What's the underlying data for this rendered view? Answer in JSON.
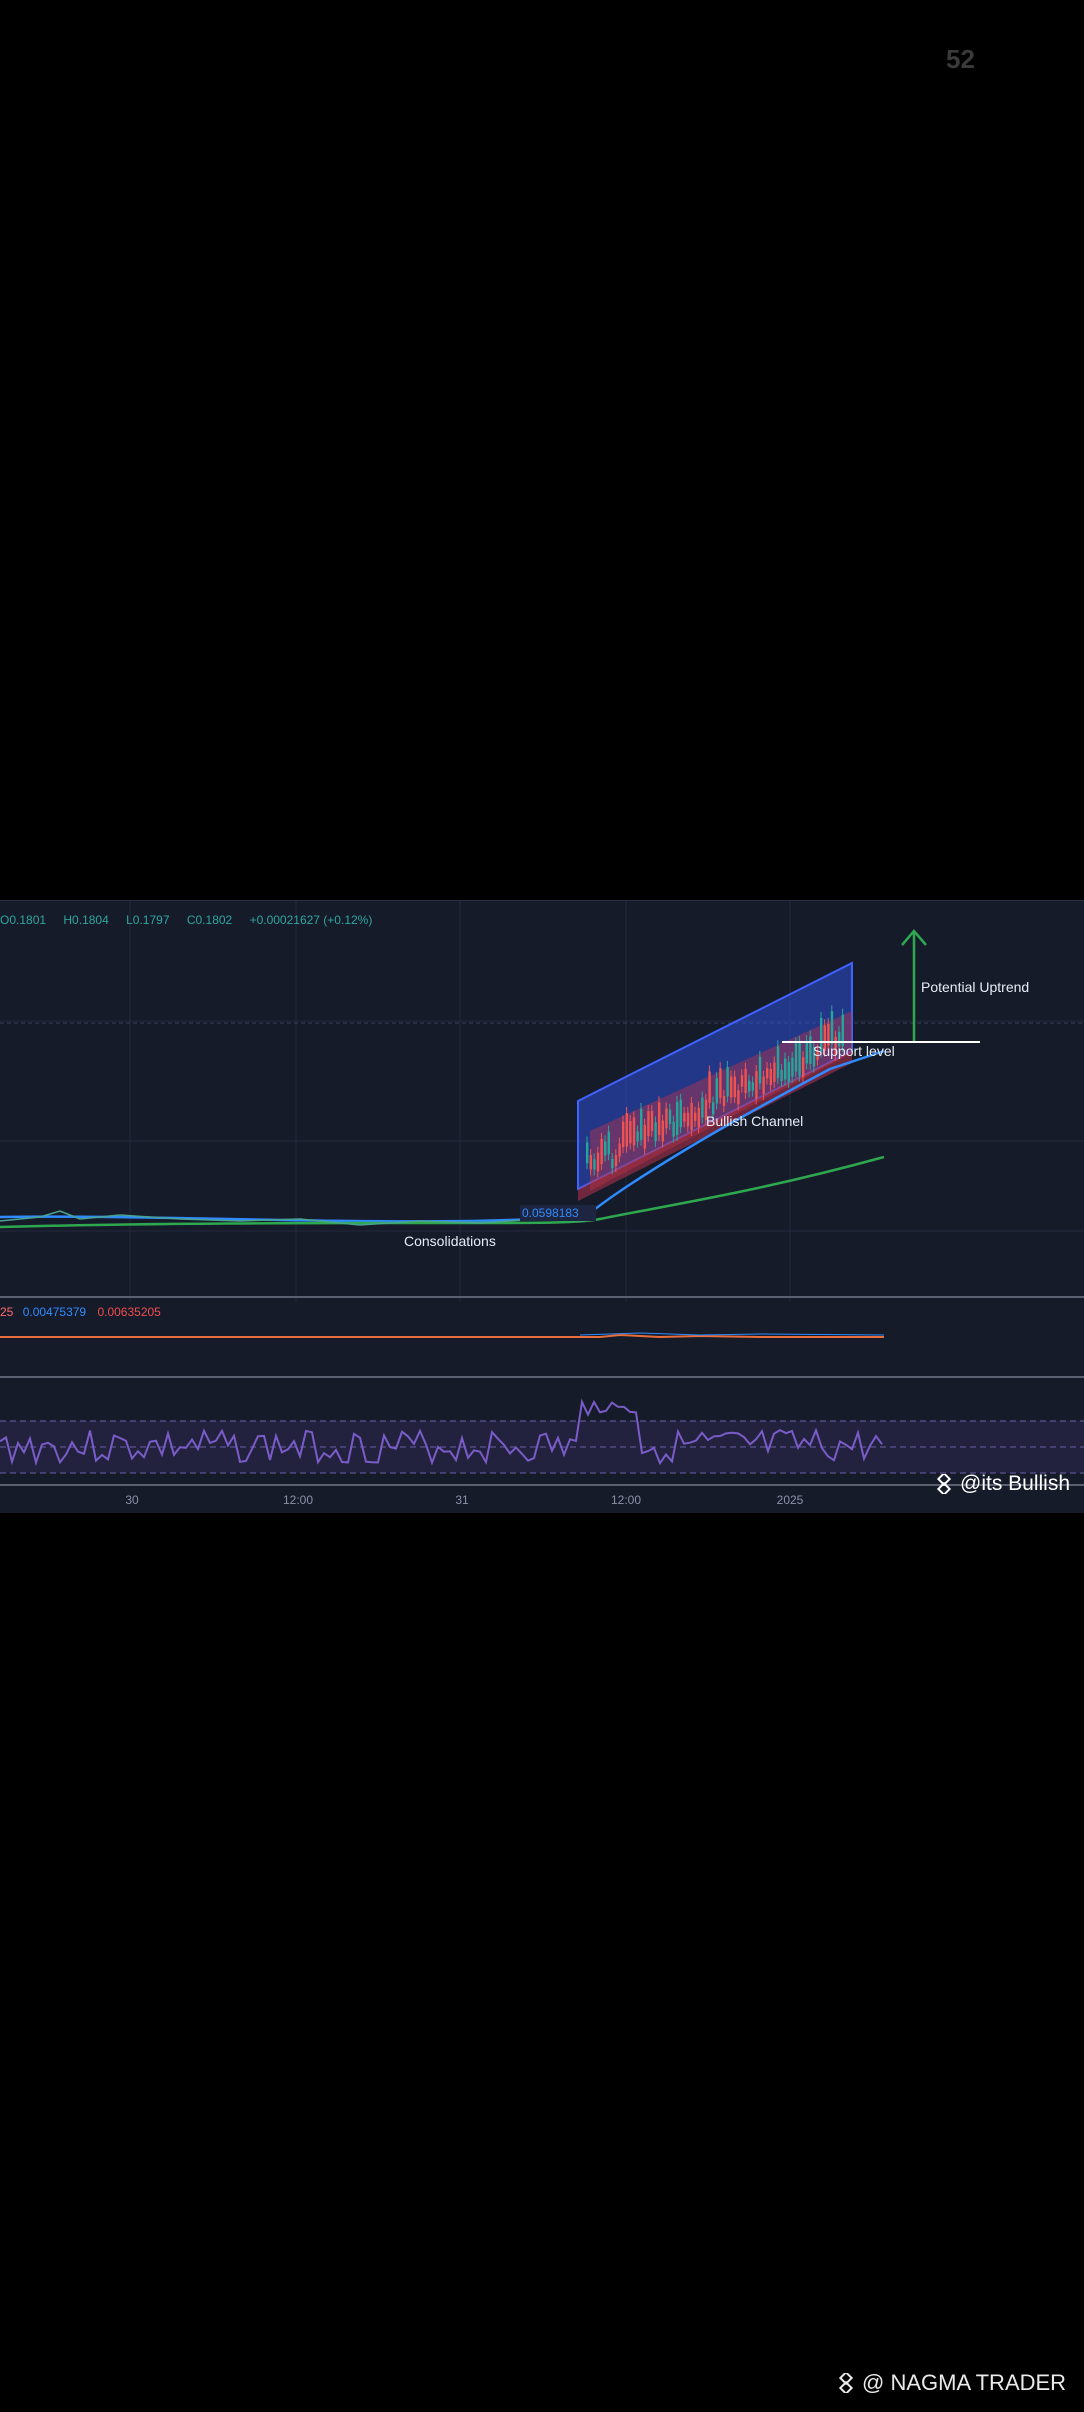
{
  "header": {
    "counter": "52"
  },
  "chart": {
    "ohlc": {
      "open": "O0.1801",
      "high": "H0.1804",
      "low": "L0.1797",
      "close": "C0.1802",
      "change": "+0.00021627 (+0.12%)"
    },
    "price_label": "0.0598183",
    "macd": {
      "label": "25",
      "value1": "0.00475379",
      "value2": "0.00635205"
    },
    "x_ticks": [
      "30",
      "12:00",
      "31",
      "12:00",
      "2025"
    ],
    "annotations": {
      "potential_uptrend": "Potential Uptrend",
      "support_level": "Support level",
      "bullish_channel": "Bullish Channel",
      "consolidations": "Consolidations"
    },
    "colors": {
      "background": "#161b2a",
      "channel_blue": "#2d4fd6",
      "channel_red": "#b8324a",
      "ema_green": "#2ea84f",
      "ema_blue": "#2f8bff",
      "rsi": "#7a5cc9",
      "arrow": "#2ea84f"
    }
  },
  "watermarks": {
    "its_bullish": "@its Bullish",
    "nagma_trader": "@ NAGMA TRADER"
  }
}
